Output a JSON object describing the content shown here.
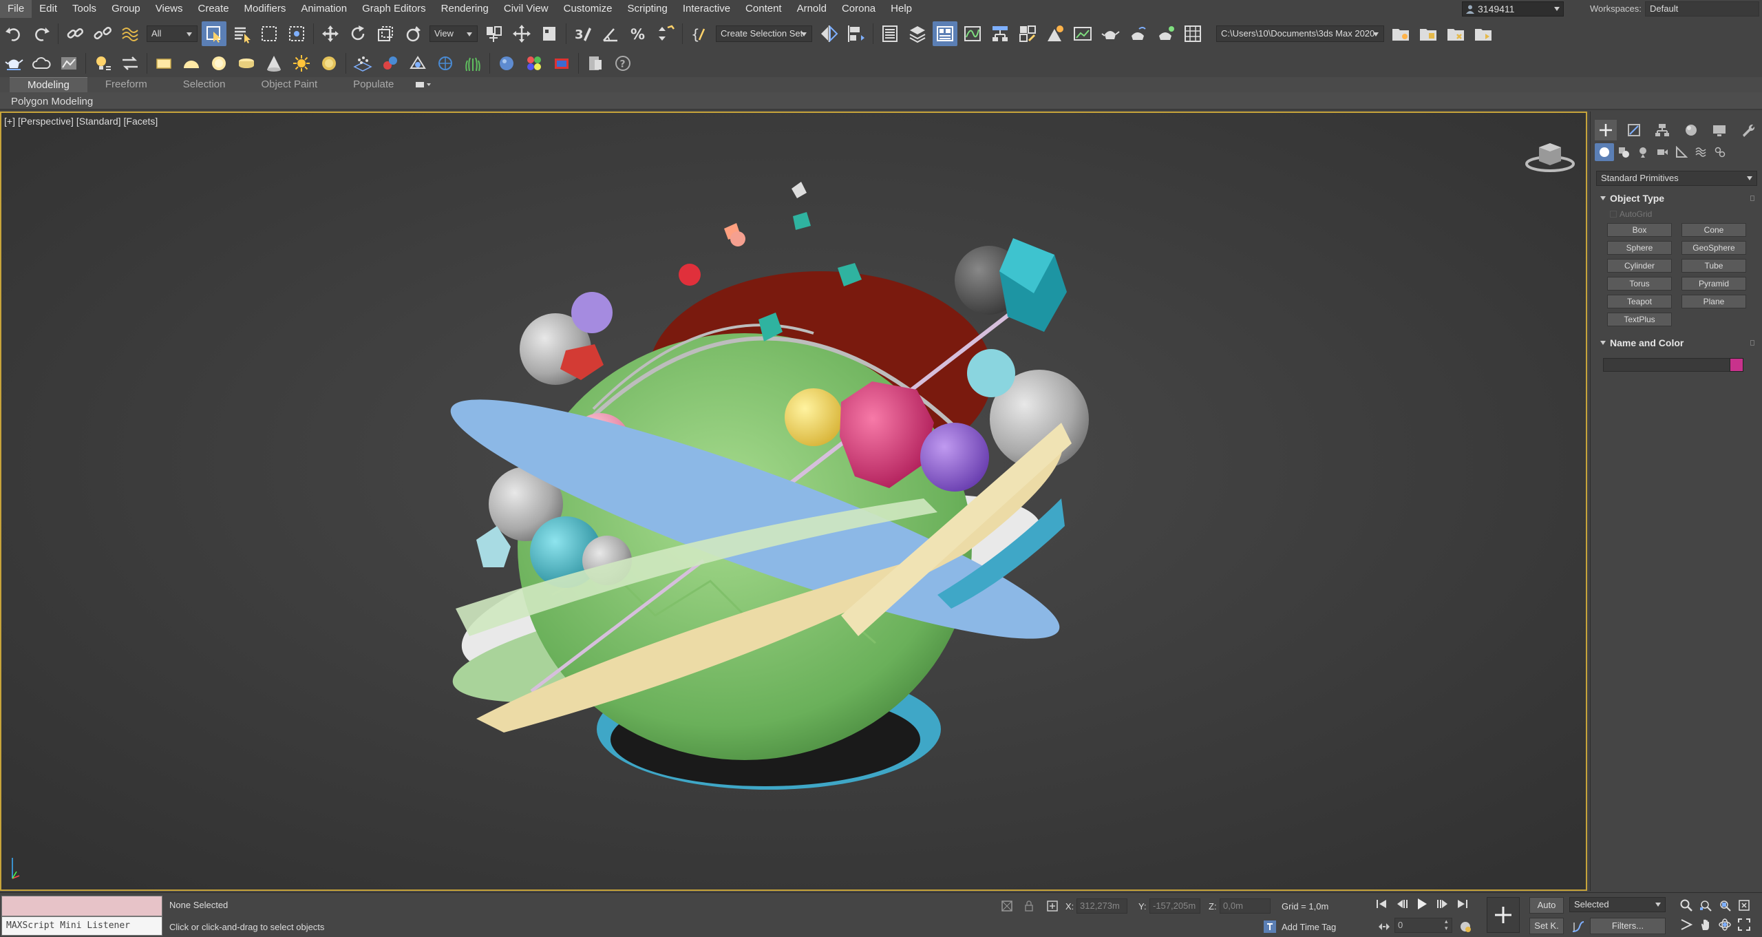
{
  "menu": {
    "items": [
      "File",
      "Edit",
      "Tools",
      "Group",
      "Views",
      "Create",
      "Modifiers",
      "Animation",
      "Graph Editors",
      "Rendering",
      "Civil View",
      "Customize",
      "Scripting",
      "Interactive",
      "Content",
      "Arnold",
      "Corona",
      "Help"
    ]
  },
  "account": {
    "name": "3149411"
  },
  "workspace": {
    "label": "Workspaces:",
    "value": "Default"
  },
  "toolbar": {
    "selection_filter": "All",
    "ref_coord": "View",
    "named_selection": "Create Selection Set",
    "project_path": "C:\\Users\\10\\Documents\\3ds Max 2020"
  },
  "ribbon": {
    "tabs": [
      "Modeling",
      "Freeform",
      "Selection",
      "Object Paint",
      "Populate"
    ],
    "panel_title": "Polygon Modeling"
  },
  "viewport": {
    "labels": [
      "[+]",
      "[Perspective]",
      "[Standard]",
      "[Facets]"
    ],
    "active_border_color": "#c7a43b"
  },
  "command_panel": {
    "primitive_type": "Standard Primitives",
    "object_type_title": "Object Type",
    "autogrid": "AutoGrid",
    "buttons": [
      "Box",
      "Cone",
      "Sphere",
      "GeoSphere",
      "Cylinder",
      "Tube",
      "Torus",
      "Pyramid",
      "Teapot",
      "Plane",
      "TextPlus"
    ],
    "name_color_title": "Name and Color",
    "object_color": "#c8328c"
  },
  "status": {
    "listener": "MAXScript Mini Listener",
    "selection": "None Selected",
    "prompt": "Click or click-and-drag to select objects",
    "x_label": "X:",
    "x_value": "312,273m",
    "y_label": "Y:",
    "y_value": "-157,205m",
    "z_label": "Z:",
    "z_value": "0,0m",
    "grid": "Grid = 1,0m",
    "time_tag": "Add Time Tag",
    "frame": "0",
    "auto_label": "Auto",
    "setk_label": "Set K.",
    "key_filter": "Selected",
    "filters_label": "Filters..."
  }
}
